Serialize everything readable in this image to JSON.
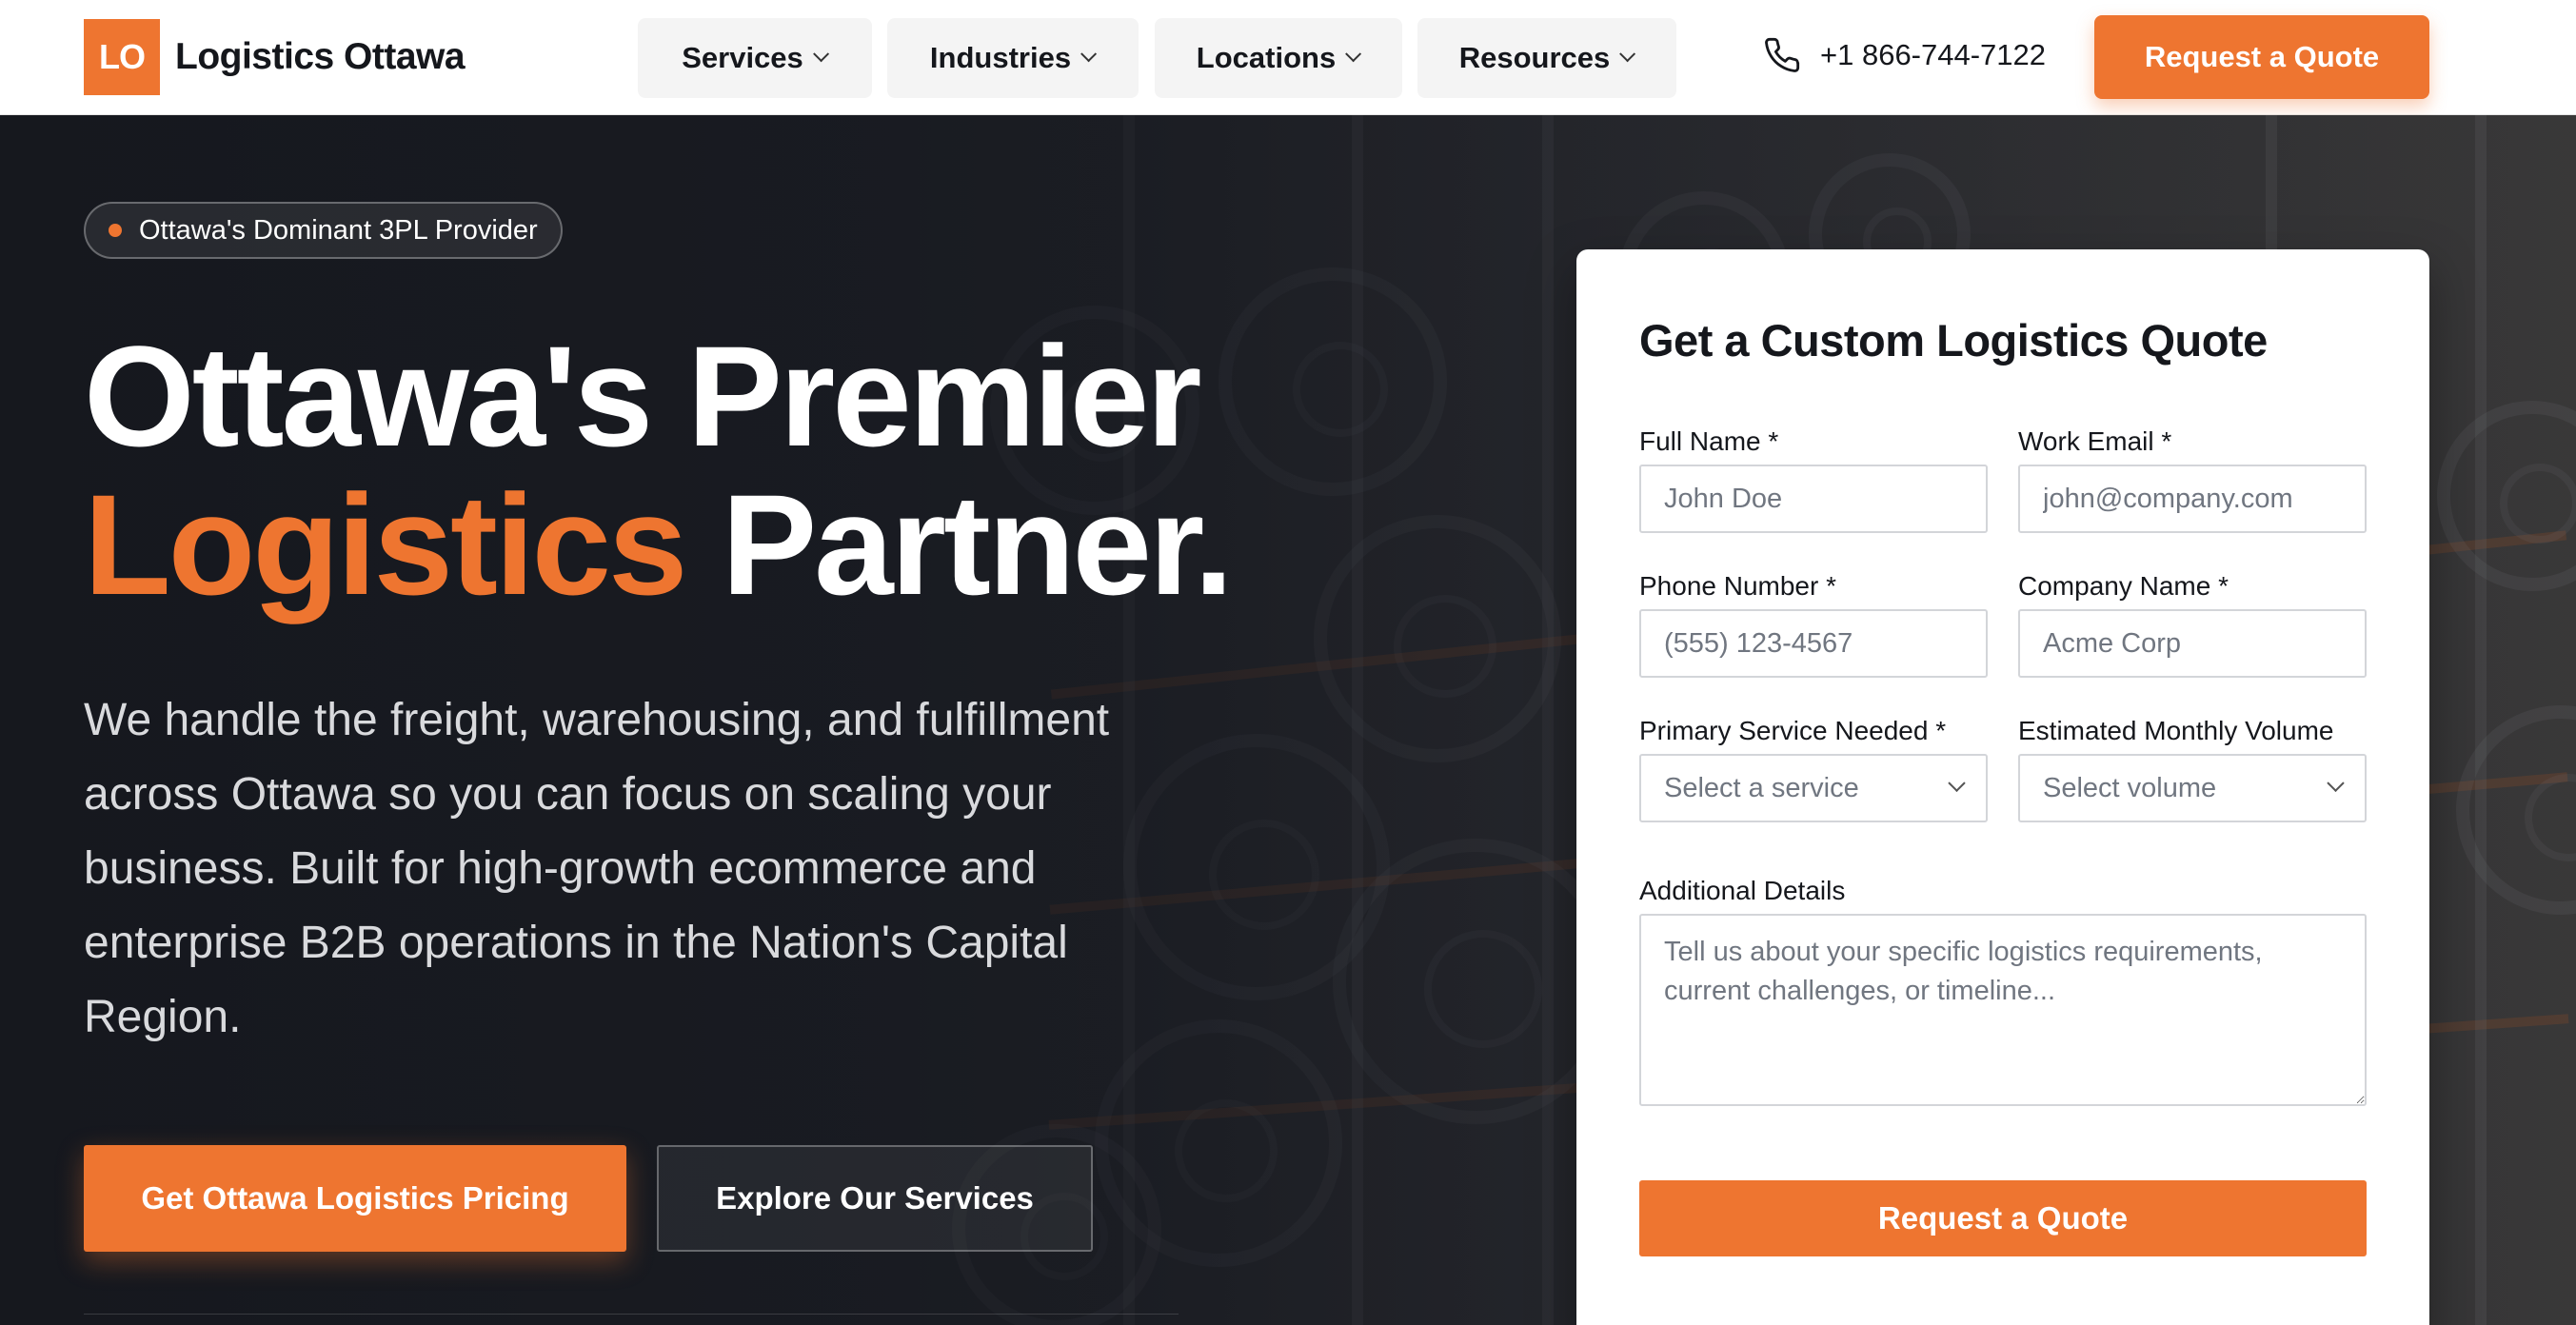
{
  "nav": {
    "logo_mark": "LO",
    "logo_text": "Logistics Ottawa",
    "menu": [
      {
        "label": "Services"
      },
      {
        "label": "Industries"
      },
      {
        "label": "Locations"
      },
      {
        "label": "Resources"
      }
    ],
    "phone": "+1 866-744-7122",
    "cta_label": "Request a Quote"
  },
  "hero": {
    "badge": "Ottawa's Dominant 3PL Provider",
    "headline_line1": "Ottawa's Premier",
    "headline_accent": "Logistics",
    "headline_rest": " Partner.",
    "subcopy": "We handle the freight, warehousing, and fulfillment across Ottawa so you can focus on scaling your business. Built for high-growth ecommerce and enterprise B2B operations in the Nation's Capital Region.",
    "primary_cta": "Get Ottawa Logistics Pricing",
    "secondary_cta": "Explore Our Services"
  },
  "form": {
    "title": "Get a Custom Logistics Quote",
    "full_name": {
      "label": "Full Name *",
      "placeholder": "John Doe",
      "value": ""
    },
    "work_email": {
      "label": "Work Email *",
      "placeholder": "john@company.com",
      "value": ""
    },
    "phone": {
      "label": "Phone Number *",
      "placeholder": "(555) 123-4567",
      "value": ""
    },
    "company": {
      "label": "Company Name *",
      "placeholder": "Acme Corp",
      "value": ""
    },
    "service": {
      "label": "Primary Service Needed *",
      "selected": "Select a service"
    },
    "volume": {
      "label": "Estimated Monthly Volume",
      "selected": "Select volume"
    },
    "details": {
      "label": "Additional Details",
      "placeholder": "Tell us about your specific logistics requirements, current challenges, or timeline..."
    },
    "submit_label": "Request a Quote"
  },
  "colors": {
    "accent": "#ee7530",
    "dark": "#15171c",
    "hero_bg": "#1c1f26"
  },
  "icons": {
    "phone": "phone-icon",
    "chevron": "chevron-down-icon"
  }
}
